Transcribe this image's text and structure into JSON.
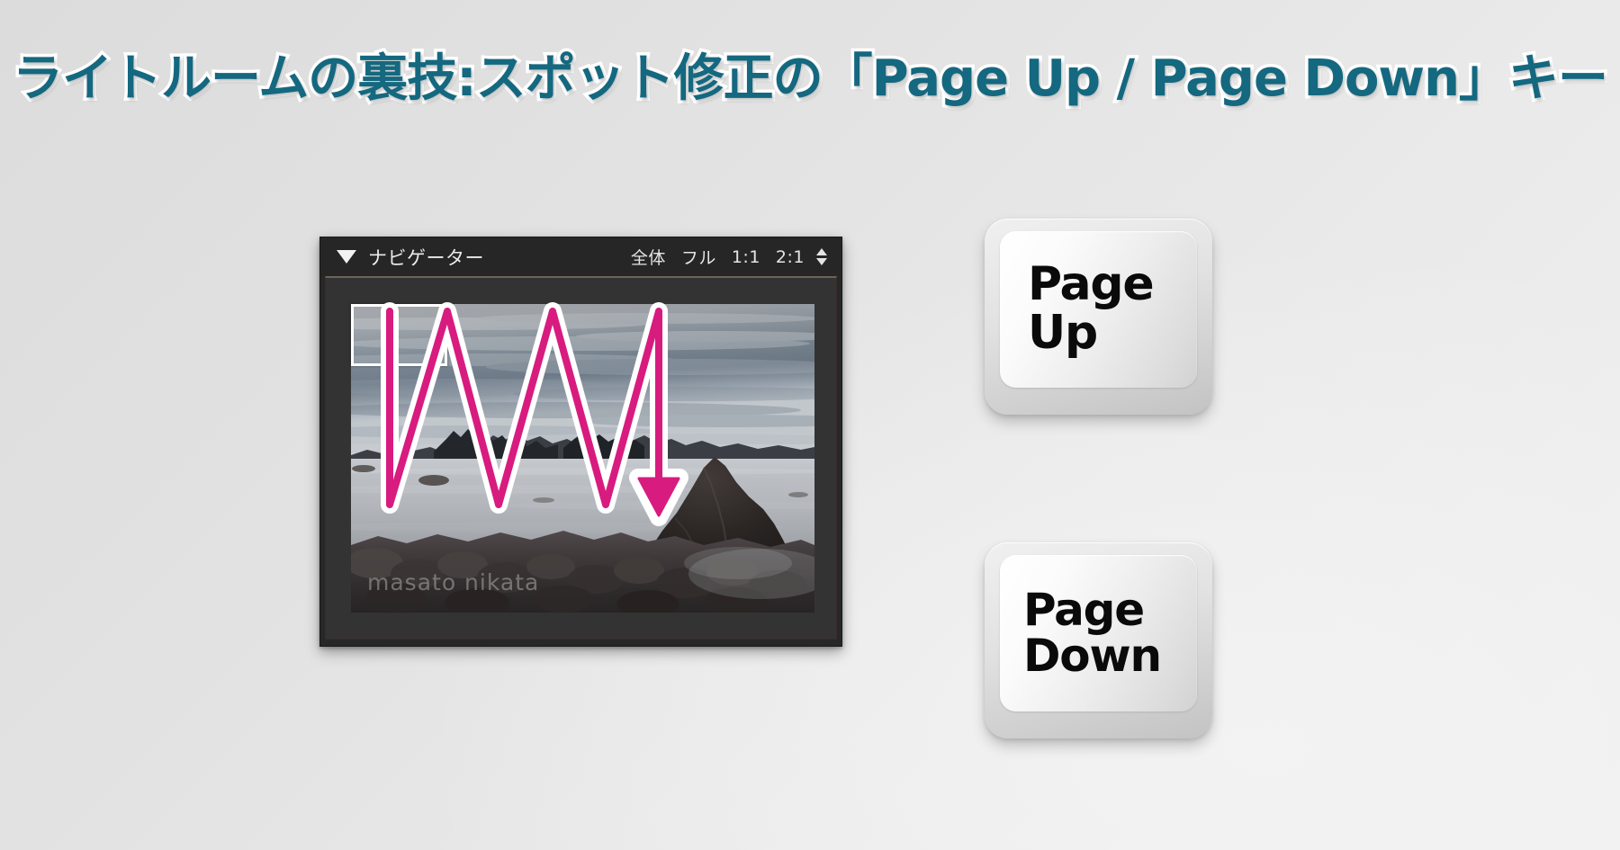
{
  "page": {
    "title": "ライトルームの裏技:スポット修正の「Page Up / Page Down」キー",
    "title_color": "#14687f",
    "title_outline_color": "#ffffff",
    "background_color": "#e6e6e6"
  },
  "navigator": {
    "disclosure_icon": "triangle-down-icon",
    "panel_title": "ナビゲーター",
    "zoom_levels": [
      {
        "id": "fit",
        "label": "全体"
      },
      {
        "id": "fill",
        "label": "フル"
      },
      {
        "id": "1to1",
        "label": "1:1"
      },
      {
        "id": "2to1",
        "label": "2:1"
      }
    ],
    "stepper_icon": "up-down-stepper-icon",
    "panel_bg": "#272727",
    "panel_well_bg": "#333333",
    "view_rect": {
      "name": "view-rectangle",
      "color": "#ffffff"
    },
    "photo": {
      "description": "長時間露光の海岸風景 — 曇り空、滑らかな海面、前景の岩",
      "watermark": "masato nikata"
    },
    "annotation": {
      "name": "serpentine-arrow",
      "shape": "zigzag-down-arrow",
      "fill_color": "#d81b7f",
      "outline_color": "#ffffff",
      "meaning": "スポット修正の移動順序"
    }
  },
  "keys": [
    {
      "name": "page-up-key",
      "lines": [
        "Page",
        "Up"
      ],
      "label": "Page Up"
    },
    {
      "name": "page-down-key",
      "lines": [
        "Page",
        "Down"
      ],
      "label": "Page Down"
    }
  ]
}
